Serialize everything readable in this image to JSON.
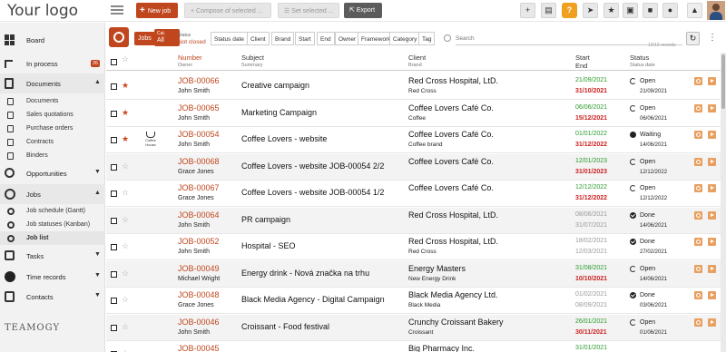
{
  "logo": "Your logo",
  "toolbar": {
    "new_job": "New job",
    "compose": "Compose of selected ...",
    "set_selected": "Set selected ...",
    "export": "Export",
    "help": "?"
  },
  "sidebar": {
    "board": "Board",
    "in_process": "In process",
    "in_process_badge": "26",
    "documents": "Documents",
    "doc_items": [
      "Documents",
      "Sales quotations",
      "Purchase orders",
      "Contracts",
      "Binders"
    ],
    "opportunities": "Opportunities",
    "jobs": "Jobs",
    "job_items": [
      "Job schedule (Gantt)",
      "Job statuses (Kanban)",
      "Job list"
    ],
    "tasks": "Tasks",
    "time_records": "Time records",
    "contacts": "Contacts",
    "bottom_logo": "TEAMOGY"
  },
  "filters": {
    "jobs": "Jobs",
    "cat_label": "Cat.",
    "cat_value": "All",
    "status_label": "Status",
    "status_value": "Not closed",
    "chips": [
      "Status date",
      "Client",
      "Brand",
      "Start",
      "End",
      "Owner",
      "Framework",
      "Category",
      "Tag"
    ],
    "search_placeholder": "Search",
    "records": "13/13 records"
  },
  "columns": {
    "number": "Number",
    "owner": "Owner",
    "subject": "Subject",
    "summary": "Summary",
    "client": "Client",
    "brand": "Brand",
    "start": "Start",
    "end": "End",
    "status": "Status",
    "status_date": "Status date"
  },
  "rows": [
    {
      "number": "JOB-00066",
      "owner": "John Smith",
      "subject": "Creative campaign",
      "client": "Red Cross Hospital, LtD.",
      "brand": "Red Cross",
      "start": "21/09/2021",
      "end": "31/10/2021",
      "status": "Open",
      "status_date": "21/09/2021"
    },
    {
      "number": "JOB-00065",
      "owner": "John Smith",
      "subject": "Marketing Campaign",
      "client": "Coffee Lovers Café Co.",
      "brand": "Coffee",
      "start": "06/06/2021",
      "end": "15/12/2021",
      "status": "Open",
      "status_date": "06/06/2021"
    },
    {
      "number": "JOB-00054",
      "owner": "John Smith",
      "subject": "Coffee Lovers - website",
      "client": "Coffee Lovers Café Co.",
      "brand": "Coffee brand",
      "start": "01/01/2022",
      "end": "31/12/2022",
      "status": "Waiting",
      "status_date": "14/06/2021",
      "logo_text": "Coffee House"
    },
    {
      "number": "JOB-00068",
      "owner": "Grace Jones",
      "subject": "Coffee Lovers - website JOB-00054 2/2",
      "client": "Coffee Lovers Café Co.",
      "brand": "",
      "start": "12/01/2023",
      "end": "31/01/2023",
      "status": "Open",
      "status_date": "12/12/2022"
    },
    {
      "number": "JOB-00067",
      "owner": "Grace Jones",
      "subject": "Coffee Lovers - website JOB-00054 1/2",
      "client": "Coffee Lovers Café Co.",
      "brand": "",
      "start": "12/12/2022",
      "end": "31/12/2022",
      "status": "Open",
      "status_date": "12/12/2022"
    },
    {
      "number": "JOB-00064",
      "owner": "John Smith",
      "subject": "PR campaign",
      "client": "Red Cross Hospital, LtD.",
      "brand": "",
      "start": "08/06/2021",
      "end": "31/07/2021",
      "status": "Done",
      "status_date": "14/06/2021"
    },
    {
      "number": "JOB-00052",
      "owner": "John Smith",
      "subject": "Hospital - SEO",
      "client": "Red Cross Hospital, LtD.",
      "brand": "Red Cross",
      "start": "18/02/2021",
      "end": "12/03/2021",
      "status": "Done",
      "status_date": "27/02/2021"
    },
    {
      "number": "JOB-00049",
      "owner": "Michael Wright",
      "subject": "Energy drink - Nová značka na trhu",
      "client": "Energy Masters",
      "brand": "New Energy Drink",
      "start": "31/08/2021",
      "end": "10/10/2021",
      "status": "Open",
      "status_date": "14/06/2021"
    },
    {
      "number": "JOB-00048",
      "owner": "Grace Jones",
      "subject": "Black Media Agency - Digital Campaign",
      "client": "Black Media Agency Ltd.",
      "brand": "Black Media",
      "start": "01/02/2021",
      "end": "08/09/2021",
      "status": "Done",
      "status_date": "03/06/2021"
    },
    {
      "number": "JOB-00046",
      "owner": "John Smith",
      "subject": "Croissant - Food festival",
      "client": "Crunchy Croissant Bakery",
      "brand": "Croissant",
      "start": "26/01/2021",
      "end": "30/11/2021",
      "status": "Open",
      "status_date": "01/06/2021"
    },
    {
      "number": "JOB-00045",
      "owner": "",
      "subject": "",
      "client": "Big Pharmacy Inc.",
      "brand": "",
      "start": "31/01/2021",
      "end": "",
      "status": "",
      "status_date": ""
    }
  ]
}
